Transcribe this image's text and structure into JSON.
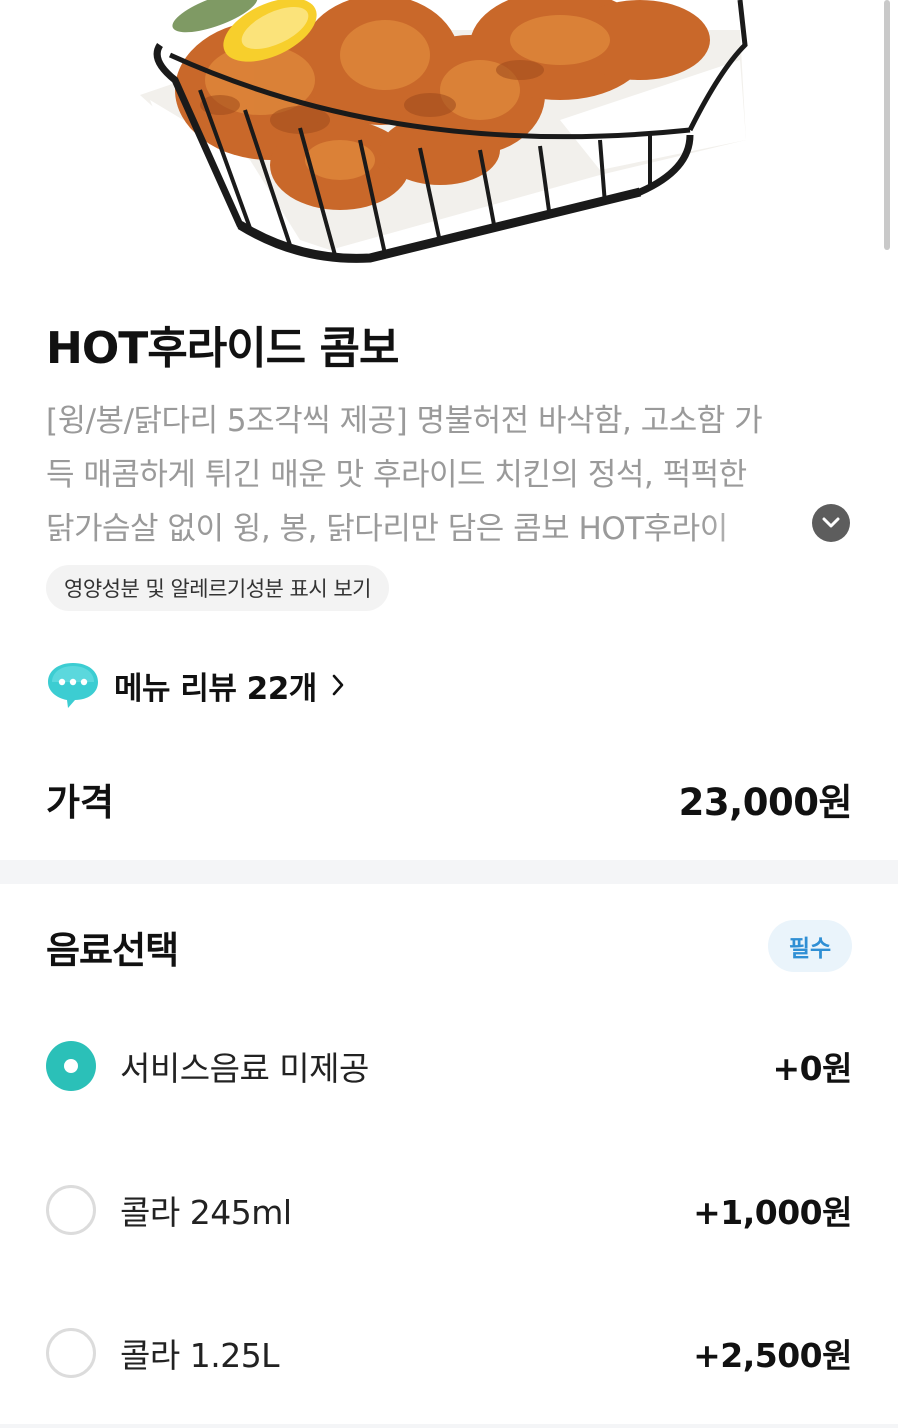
{
  "menu": {
    "title": "HOT후라이드 콤보",
    "description_lines": [
      "[윙/봉/닭다리 5조각씩 제공] 명불허전 바삭함, 고소함 가",
      "득 매콤하게 튀긴 매운 맛 후라이드 치킨의 정석, 퍽퍽한",
      "닭가슴살 없이 윙, 봉, 닭다리만 담은 콤보 HOT후라이"
    ],
    "nutrition_link": "영양성분 및 알레르기성분 표시 보기",
    "review_link": "메뉴 리뷰 22개",
    "price_label": "가격",
    "price_value": "23,000원",
    "hero_image": "fried-chicken-in-black-wire-basket"
  },
  "option_group": {
    "title": "음료선택",
    "badge": "필수",
    "options": [
      {
        "label": "서비스음료 미제공",
        "price": "+0원",
        "selected": true
      },
      {
        "label": "콜라 245ml",
        "price": "+1,000원",
        "selected": false
      },
      {
        "label": "콜라 1.25L",
        "price": "+2,500원",
        "selected": false
      }
    ]
  },
  "colors": {
    "accent": "#2bc0b8",
    "badge_text": "#2f8fd4",
    "badge_bg": "#eaf4fb",
    "muted_text": "#9a9a9a",
    "divider": "#f4f5f7"
  },
  "icons": {
    "expand": "chevron-down-icon",
    "review": "speech-bubble-icon",
    "review_arrow": "chevron-right-icon"
  }
}
